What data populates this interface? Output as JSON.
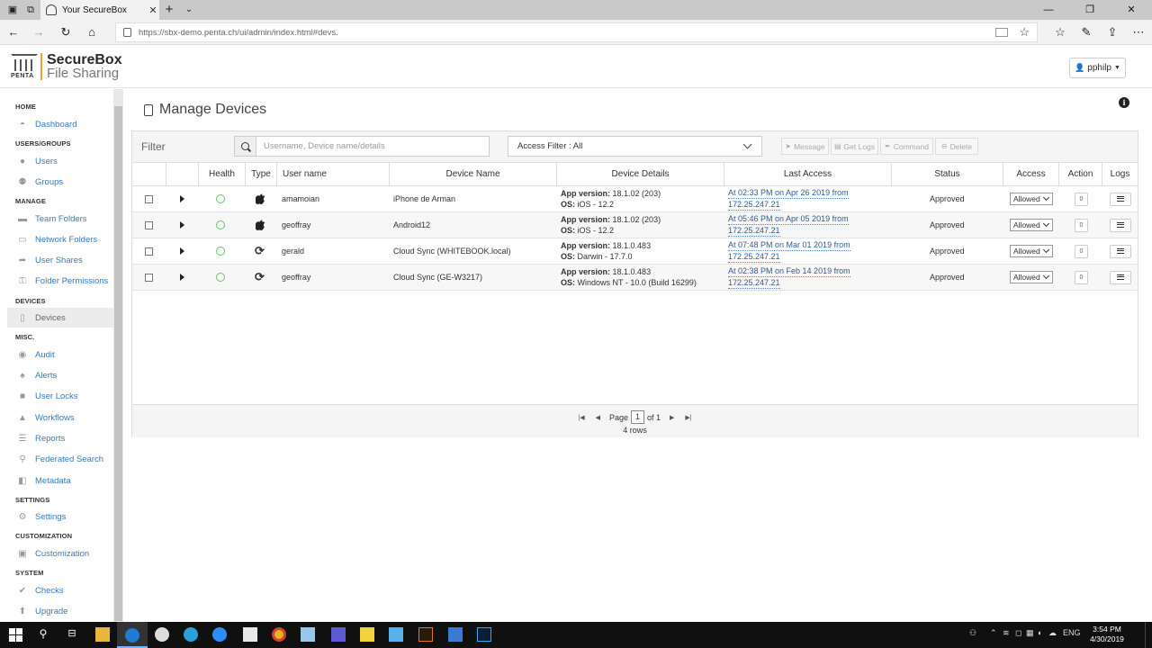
{
  "browser": {
    "tab_title": "Your SecureBox",
    "url": "https://sbx-demo.penta.ch/ui/admin/index.html#devs."
  },
  "app": {
    "logo_small": "PENTA",
    "brand_line1": "SecureBox",
    "brand_line2": "File Sharing",
    "user": "pphilp"
  },
  "sidebar": {
    "sections": [
      {
        "title": "HOME",
        "items": [
          {
            "label": "Dashboard",
            "icon": "dashboard-icon"
          }
        ]
      },
      {
        "title": "USERS/GROUPS",
        "items": [
          {
            "label": "Users",
            "icon": "user-icon"
          },
          {
            "label": "Groups",
            "icon": "group-icon"
          }
        ]
      },
      {
        "title": "MANAGE",
        "items": [
          {
            "label": "Team Folders",
            "icon": "folder-icon"
          },
          {
            "label": "Network Folders",
            "icon": "network-folder-icon"
          },
          {
            "label": "User Shares",
            "icon": "share-icon"
          },
          {
            "label": "Folder Permissions",
            "icon": "key-icon"
          }
        ]
      },
      {
        "title": "DEVICES",
        "items": [
          {
            "label": "Devices",
            "icon": "device-icon",
            "active": true
          }
        ]
      },
      {
        "title": "MISC.",
        "items": [
          {
            "label": "Audit",
            "icon": "eye-icon"
          },
          {
            "label": "Alerts",
            "icon": "bell-icon"
          },
          {
            "label": "User Locks",
            "icon": "lock-icon"
          },
          {
            "label": "Workflows",
            "icon": "workflow-icon"
          },
          {
            "label": "Reports",
            "icon": "report-icon"
          },
          {
            "label": "Federated Search",
            "icon": "search-icon"
          },
          {
            "label": "Metadata",
            "icon": "metadata-icon"
          }
        ]
      },
      {
        "title": "SETTINGS",
        "items": [
          {
            "label": "Settings",
            "icon": "gear-icon"
          }
        ]
      },
      {
        "title": "CUSTOMIZATION",
        "items": [
          {
            "label": "Customization",
            "icon": "image-icon"
          }
        ]
      },
      {
        "title": "SYSTEM",
        "items": [
          {
            "label": "Checks",
            "icon": "check-icon"
          },
          {
            "label": "Upgrade",
            "icon": "upgrade-icon"
          }
        ]
      }
    ]
  },
  "main": {
    "title": "Manage Devices",
    "filter_label": "Filter",
    "search_placeholder": "Username, Device name/details",
    "access_filter": "Access Filter : All",
    "buttons": {
      "message": "Message",
      "get_logs": "Get Logs",
      "command": "Command",
      "delete": "Delete"
    },
    "columns": [
      "Health",
      "Type",
      "User name",
      "Device Name",
      "Device Details",
      "Last Access",
      "Status",
      "Access",
      "Action",
      "Logs"
    ],
    "app_version_label": "App version:",
    "os_label": "OS:",
    "rows": [
      {
        "type": "apple-icon",
        "user": "amamoian",
        "device": "iPhone de Arman",
        "app_version": "18.1.02 (203)",
        "os": "iOS - 12.2",
        "last_access_1": "At 02:33 PM on Apr 26 2019 from",
        "last_access_2": "172.25.247.21",
        "status": "Approved",
        "access": "Allowed",
        "action": "0"
      },
      {
        "type": "apple-icon",
        "user": "geoffray",
        "device": "Android12",
        "app_version": "18.1.02 (203)",
        "os": "iOS - 12.2",
        "last_access_1": "At 05:46 PM on Apr 05 2019 from",
        "last_access_2": "172.25.247.21",
        "status": "Approved",
        "access": "Allowed",
        "action": "0"
      },
      {
        "type": "sync-icon",
        "user": "gerald",
        "device": "Cloud Sync (WHITEBOOK.local)",
        "app_version": "18.1.0.483",
        "os": "Darwin - 17.7.0",
        "last_access_1": "At 07:48 PM on Mar 01 2019 from",
        "last_access_2": "172.25.247.21",
        "status": "Approved",
        "access": "Allowed",
        "action": "0"
      },
      {
        "type": "sync-icon",
        "user": "geoffray",
        "device": "Cloud Sync (GE-W3217)",
        "app_version": "18.1.0.483",
        "os": "Windows NT - 10.0 (Build 16299)",
        "last_access_1": "At 02:38 PM on Feb 14 2019 from",
        "last_access_2": "172.25.247.21",
        "status": "Approved",
        "access": "Allowed",
        "action": "0"
      }
    ],
    "pager": {
      "page_label": "Page",
      "page": "1",
      "of_label": "of 1",
      "rows": "4 rows"
    }
  },
  "taskbar": {
    "lang": "ENG",
    "time": "3:54 PM",
    "date": "4/30/2019"
  }
}
